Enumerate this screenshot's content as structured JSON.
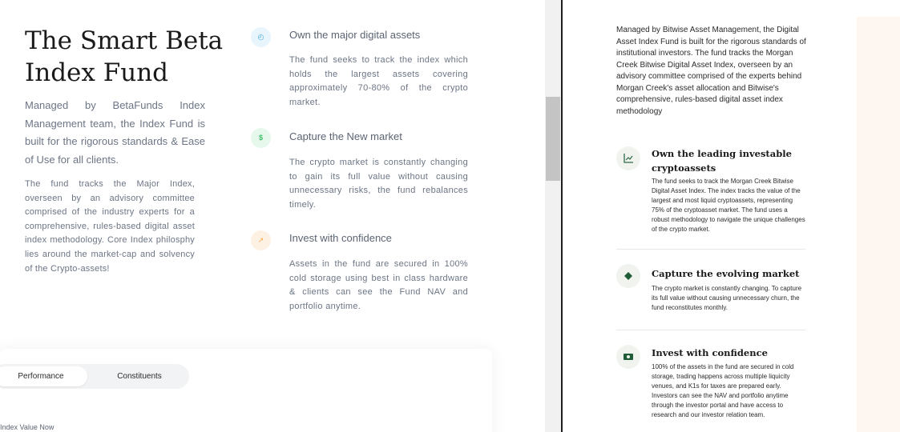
{
  "colors": {
    "accent_blue": "#3aa7e8",
    "accent_green": "#3fbf6b",
    "accent_orange": "#f5a742",
    "dark_green": "#1f5c38"
  },
  "hero": {
    "title_line1": "The Smart Beta",
    "title_line2": "Index Fund",
    "lead": "Managed by BetaFunds Index Management team, the Index Fund is built for the rigorous standards & Ease of Use for all clients.",
    "body": "The fund tracks the Major Index, overseen by an advisory committee comprised of the industry experts for a comprehensive, rules-based digital asset index methodology. Core Index philosphy lies around the market-cap and solvency of the Crypto-assets!"
  },
  "features": [
    {
      "icon": "clock-icon",
      "title": "Own the major digital assets",
      "desc": "The fund seeks to track the index which holds the largest assets covering approximately 70-80% of the crypto market."
    },
    {
      "icon": "dollar-icon",
      "title": "Capture the New market",
      "desc": "The crypto market is constantly changing to gain its full value without causing unnecessary risks, the fund rebalances timely."
    },
    {
      "icon": "trend-icon",
      "title": "Invest with confidence",
      "desc": "Assets in the fund are secured in 100% cold storage using best in class hardware & clients can see the Fund NAV and portfolio anytime."
    }
  ],
  "tabs": [
    "Performance",
    "Constituents"
  ],
  "index_value_label": "Index Value Now",
  "right": {
    "intro": "Managed by Bitwise Asset Management, the Digital Asset Index Fund is built for the rigorous standards of institutional investors. The fund tracks the Morgan Creek Bitwise Digital Asset Index, overseen by an advisory committee comprised of the experts behind Morgan Creek's asset allocation and Bitwise's comprehensive, rules-based digital asset index methodology",
    "items": [
      {
        "icon": "chart-icon",
        "title": "Own the leading investable cryptoassets",
        "desc": "The fund seeks to track the Morgan Creek Bitwise Digital Asset Index. The index tracks the value of the largest and most liquid cryptoassets, representing 75% of the cryptoasset market. The fund uses a robust methodology to navigate the unique challenges of the crypto market."
      },
      {
        "icon": "diamond-icon",
        "title": "Capture the evolving market",
        "desc": "The crypto market is constantly changing. To capture its full value without causing unnecessary churn, the fund reconstitutes monthly."
      },
      {
        "icon": "cash-icon",
        "title": "Invest with confidence",
        "desc": "100% of the assets in the fund are secured in cold storage, trading happens across multiple liquicity venues, and K1s for taxes are prepared early. Investors can see the NAV and portfolio anytime through the investor portal and have access to research and our investor relation team."
      }
    ]
  }
}
